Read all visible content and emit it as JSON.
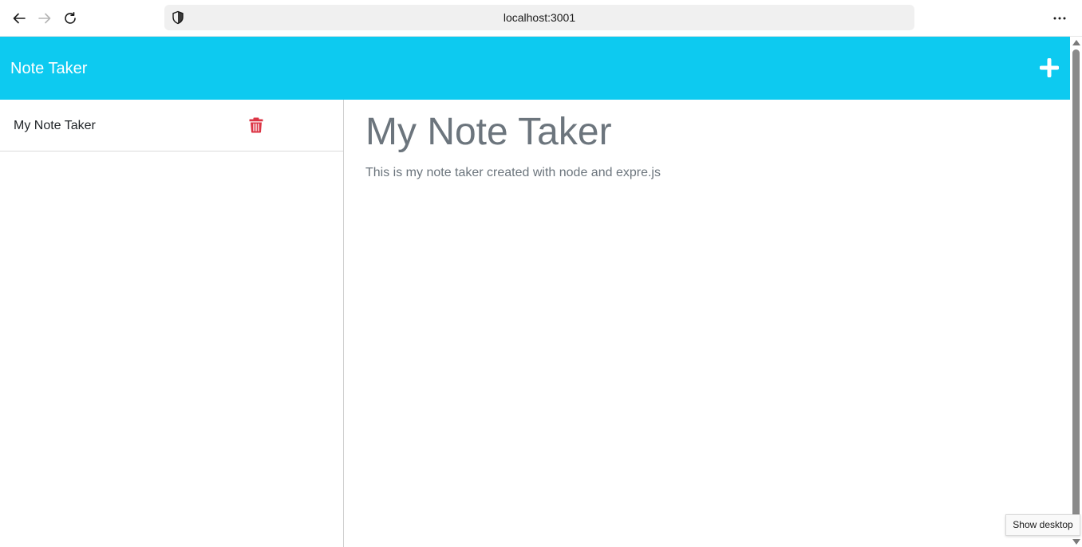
{
  "browser": {
    "url": "localhost:3001",
    "back_icon": "arrow-left-icon",
    "forward_icon": "arrow-right-icon",
    "reload_icon": "reload-icon",
    "shield_icon": "shield-icon",
    "menu_icon": "more-horizontal-icon"
  },
  "header": {
    "title": "Note Taker",
    "add_icon": "plus-icon"
  },
  "sidebar": {
    "items": [
      {
        "label": "My Note Taker",
        "delete_icon": "trash-icon"
      }
    ]
  },
  "note": {
    "title": "My Note Taker",
    "text": "This is my note taker created with node and expre.js"
  },
  "tooltip": {
    "text": "Show desktop"
  },
  "colors": {
    "header_bg": "#0dcaf0",
    "header_text": "#ffffff",
    "delete_icon": "#dc3545",
    "note_text": "#6c757d"
  }
}
